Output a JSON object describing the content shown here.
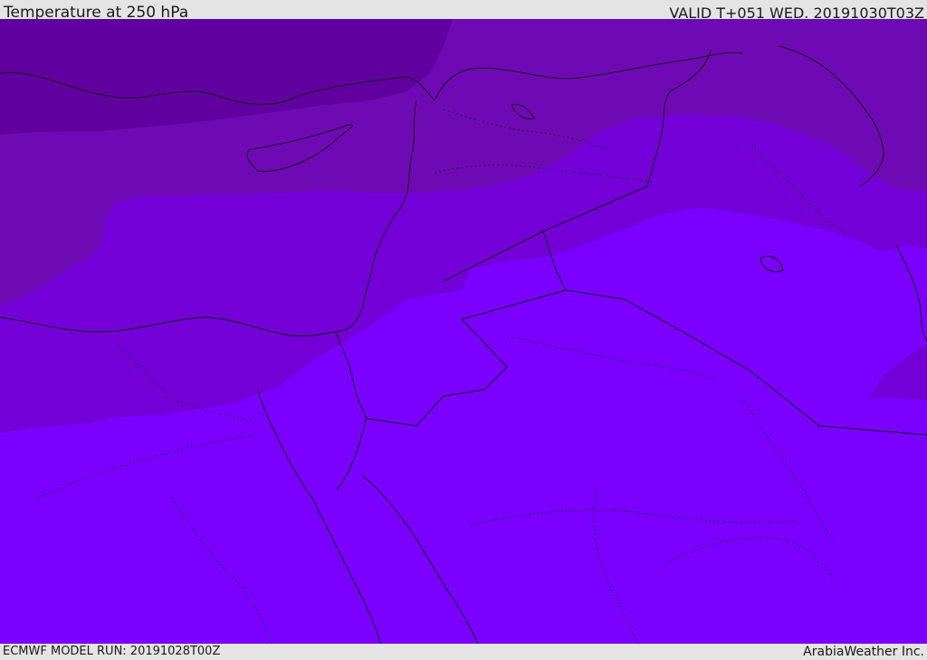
{
  "header": {
    "title": "Temperature at 250 hPa",
    "valid": "VALID T+051 WED. 20191030T03Z"
  },
  "footer": {
    "model_run": "ECMWF MODEL RUN: 20191028T00Z",
    "credit": "ArabiaWeather Inc."
  },
  "map": {
    "fill_colors": {
      "coldest": "#5f009f",
      "cold": "#6e0ab4",
      "mid": "#7300d6",
      "warm": "#7a00ff",
      "boundary_line": "#1a1a1a"
    }
  }
}
